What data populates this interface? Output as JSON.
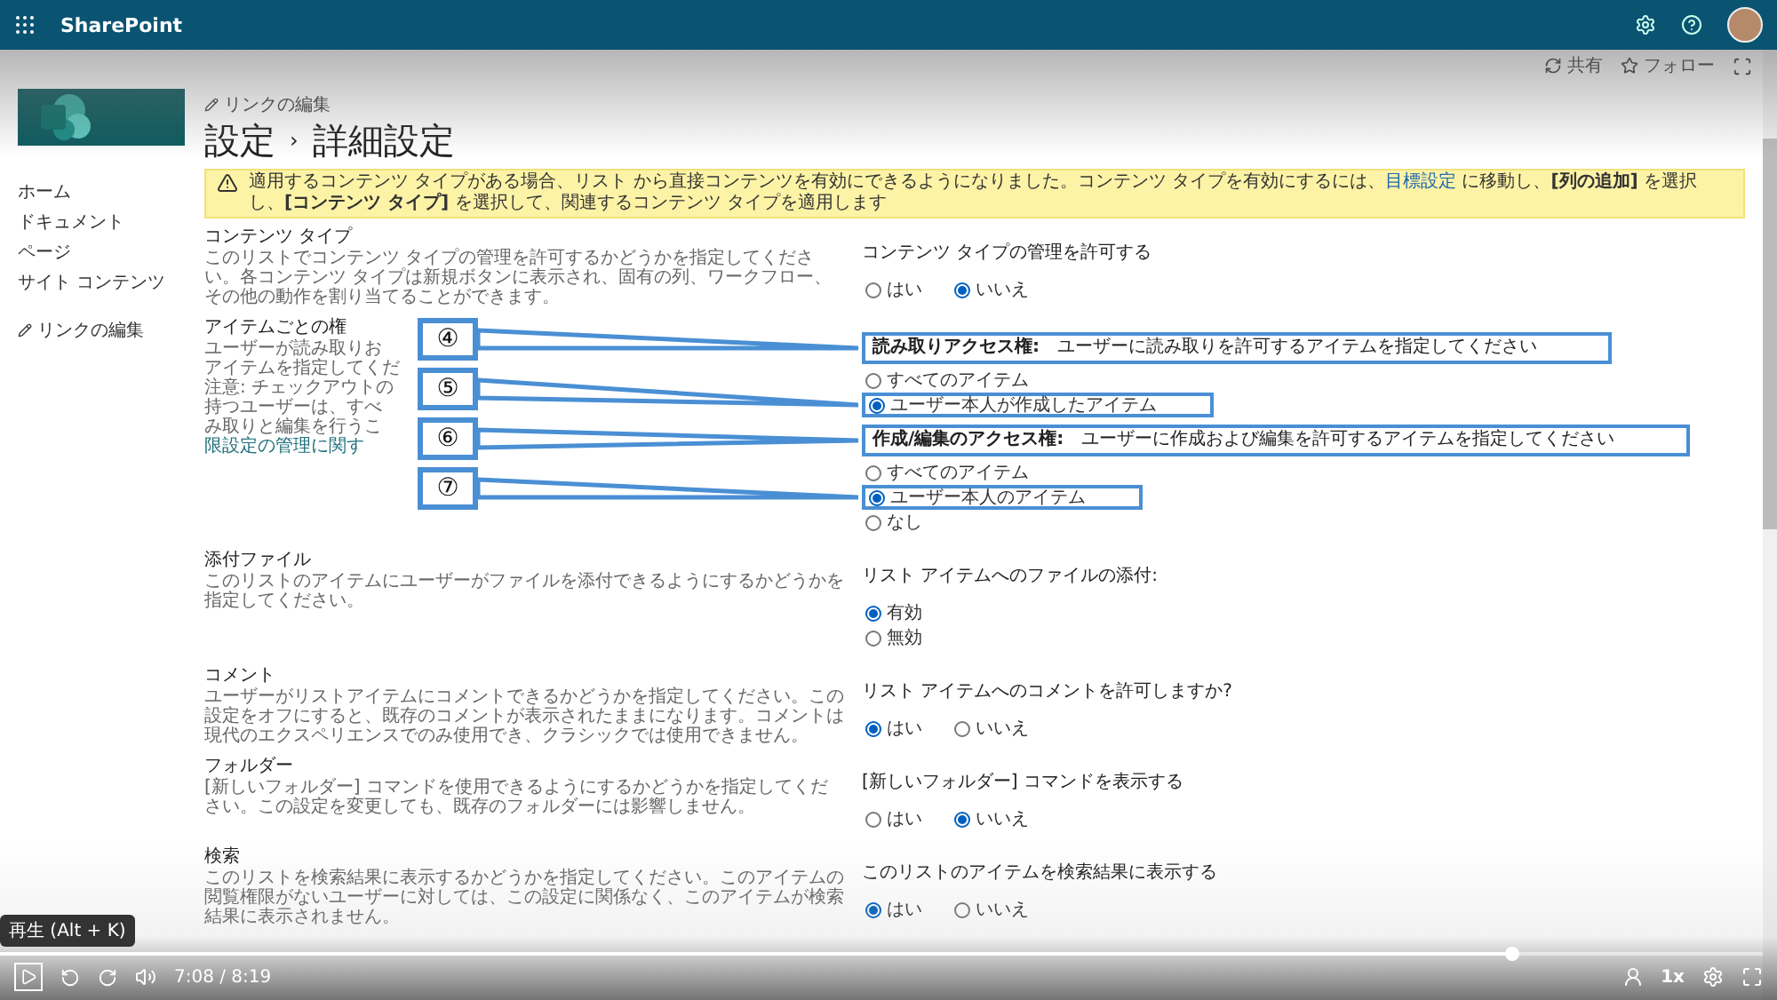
{
  "app_bar": {
    "title": "SharePoint"
  },
  "command_bar": {
    "items": [
      {
        "kind": "share",
        "label": "共有"
      },
      {
        "kind": "follow",
        "label": "フォロー"
      }
    ]
  },
  "nav": {
    "items": [
      "ホーム",
      "ドキュメント",
      "ページ",
      "サイト コンテンツ"
    ],
    "edit_link": "リンクの編集"
  },
  "header": {
    "edit_link": "リンクの編集",
    "title": "設定",
    "separator": "›",
    "subtitle": "詳細設定"
  },
  "banner": {
    "before": "適用するコンテンツ タイプがある場合、リスト から直接コンテンツを有効にできるようになりました。コンテンツ タイプを有効にするには、",
    "link": "目標設定",
    "after": "に移動し、**[列の追加]** を選択し、**[コンテンツ タイプ]** を選択して、関連するコンテンツ タイプを適用します"
  },
  "sections": [
    {
      "title": "コンテンツ タイプ",
      "description": "このリストでコンテンツ タイプの管理を許可するかどうかを指定してください。各コンテンツ タイプは新規ボタンに表示され、固有の列、ワークフロー、その他の動作を割り当てることができます。",
      "groups": [
        {
          "label": "コンテンツ タイプの管理を許可する",
          "kind": "inline",
          "options": [
            {
              "label": "はい",
              "selected": false
            },
            {
              "label": "いいえ",
              "selected": true
            }
          ]
        }
      ]
    },
    {
      "title": "アイテムごとの権",
      "fragments": [
        "ユーザーが読み取りお",
        "アイテムを指定してくだ",
        "注意: チェックアウトの",
        "持つユーザーは、すべ",
        "み取りと編集を行うこ"
      ],
      "fragment_link": "限設定の管理に関す",
      "groups": [
        {
          "label": "**読み取りアクセス権:**　ユーザーに読み取りを許可するアイテムを指定してください",
          "highlighted": true,
          "kind": "stacked",
          "options": [
            {
              "label": "すべてのアイテム",
              "selected": false,
              "highlighted": false
            },
            {
              "label": "ユーザー本人が作成したアイテム",
              "selected": true,
              "highlighted": true
            }
          ]
        },
        {
          "label": "**作成/編集のアクセス権:**　ユーザーに作成および編集を許可するアイテムを指定してください",
          "highlighted": true,
          "kind": "stacked",
          "options": [
            {
              "label": "すべてのアイテム",
              "selected": false,
              "highlighted": false
            },
            {
              "label": "ユーザー本人のアイテム",
              "selected": true,
              "highlighted": true
            },
            {
              "label": "なし",
              "selected": false,
              "highlighted": false
            }
          ]
        }
      ],
      "callouts": [
        {
          "number": "④"
        },
        {
          "number": "⑤"
        },
        {
          "number": "⑥"
        },
        {
          "number": "⑦"
        }
      ]
    },
    {
      "title": "添付ファイル",
      "description": "このリストのアイテムにユーザーがファイルを添付できるようにするかどうかを指定してください。",
      "groups": [
        {
          "label": "リスト アイテムへのファイルの添付:",
          "kind": "stacked",
          "options": [
            {
              "label": "有効",
              "selected": true
            },
            {
              "label": "無効",
              "selected": false
            }
          ]
        }
      ]
    },
    {
      "title": "コメント",
      "description": "ユーザーがリストアイテムにコメントできるかどうかを指定してください。この設定をオフにすると、既存のコメントが表示されたままになります。コメントは現代のエクスペリエンスでのみ使用でき、クラシックでは使用できません。",
      "groups": [
        {
          "label": "リスト アイテムへのコメントを許可しますか?",
          "kind": "inline",
          "options": [
            {
              "label": "はい",
              "selected": true
            },
            {
              "label": "いいえ",
              "selected": false
            }
          ]
        }
      ]
    },
    {
      "title": "フォルダー",
      "description": "[新しいフォルダー] コマンドを使用できるようにするかどうかを指定してください。この設定を変更しても、既存のフォルダーには影響しません。",
      "groups": [
        {
          "label": "[新しいフォルダー] コマンドを表示する",
          "kind": "inline",
          "options": [
            {
              "label": "はい",
              "selected": false
            },
            {
              "label": "いいえ",
              "selected": true
            }
          ]
        }
      ]
    },
    {
      "title": "検索",
      "description": "このリストを検索結果に表示するかどうかを指定してください。このアイテムの閲覧権限がないユーザーに対しては、この設定に関係なく、このアイテムが検索結果に表示されません。",
      "groups": [
        {
          "label": "このリストのアイテムを検索結果に表示する",
          "kind": "inline",
          "options": [
            {
              "label": "はい",
              "selected": true
            },
            {
              "label": "いいえ",
              "selected": false
            }
          ]
        }
      ]
    }
  ],
  "player": {
    "tooltip": "再生 (Alt + K)",
    "level": 0.858,
    "time": "7:08 / 8:19",
    "speed": "1x"
  }
}
